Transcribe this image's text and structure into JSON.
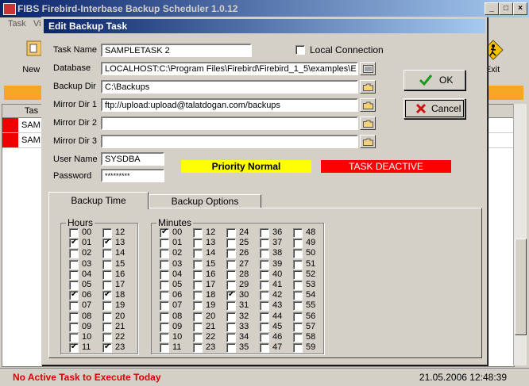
{
  "main": {
    "title": "FIBS  Firebird-Interbase Backup Scheduler 1.0.12",
    "menu": [
      "Task",
      "Vi"
    ],
    "toolbar": {
      "new_label": "New T",
      "exit_label": "Exit"
    },
    "grid": {
      "header": "Tas",
      "rows": [
        "SAMI",
        "SAMI"
      ]
    },
    "status": {
      "message": "No Active Task to Execute Today",
      "datetime": "21.05.2006 12:48:39"
    }
  },
  "dialog": {
    "title": "Edit Backup Task",
    "labels": {
      "task_name": "Task Name",
      "database": "Database",
      "backup_dir": "Backup Dir",
      "mirror1": "Mirror Dir 1",
      "mirror2": "Mirror Dir 2",
      "mirror3": "Mirror Dir 3",
      "user_name": "User Name",
      "password": "Password",
      "local_connection": "Local Connection"
    },
    "values": {
      "task_name": "SAMPLETASK 2",
      "database": "LOCALHOST:C:\\Program Files\\Firebird\\Firebird_1_5\\examples\\EMP",
      "backup_dir": "C:\\Backups",
      "mirror1": "ftp://upload:upload@talatdogan.com/backups",
      "mirror2": "",
      "mirror3": "",
      "user_name": "SYSDBA",
      "password": "*********"
    },
    "local_connection_checked": false,
    "ok_label": "OK",
    "cancel_label": "Cancel",
    "priority": "Priority Normal",
    "task_state": "TASK DEACTIVE",
    "colors": {
      "priority_bg": "#ffff00",
      "state_bg": "#ff0000",
      "title_start": "#0a246a",
      "title_end": "#a6caf0"
    },
    "tabs": [
      "Backup Time",
      "Backup Options"
    ],
    "hours_label": "Hours",
    "minutes_label": "Minutes",
    "hours": [
      {
        "v": "00",
        "c": false
      },
      {
        "v": "01",
        "c": true
      },
      {
        "v": "02",
        "c": false
      },
      {
        "v": "03",
        "c": false
      },
      {
        "v": "04",
        "c": false
      },
      {
        "v": "05",
        "c": false
      },
      {
        "v": "06",
        "c": true
      },
      {
        "v": "07",
        "c": false
      },
      {
        "v": "08",
        "c": false
      },
      {
        "v": "09",
        "c": false
      },
      {
        "v": "10",
        "c": false
      },
      {
        "v": "11",
        "c": true
      },
      {
        "v": "12",
        "c": false
      },
      {
        "v": "13",
        "c": true
      },
      {
        "v": "14",
        "c": false
      },
      {
        "v": "15",
        "c": false
      },
      {
        "v": "16",
        "c": false
      },
      {
        "v": "17",
        "c": false
      },
      {
        "v": "18",
        "c": true
      },
      {
        "v": "19",
        "c": false
      },
      {
        "v": "20",
        "c": false
      },
      {
        "v": "21",
        "c": false
      },
      {
        "v": "22",
        "c": false
      },
      {
        "v": "23",
        "c": true
      }
    ],
    "minutes_checked": [
      "00",
      "30"
    ]
  }
}
